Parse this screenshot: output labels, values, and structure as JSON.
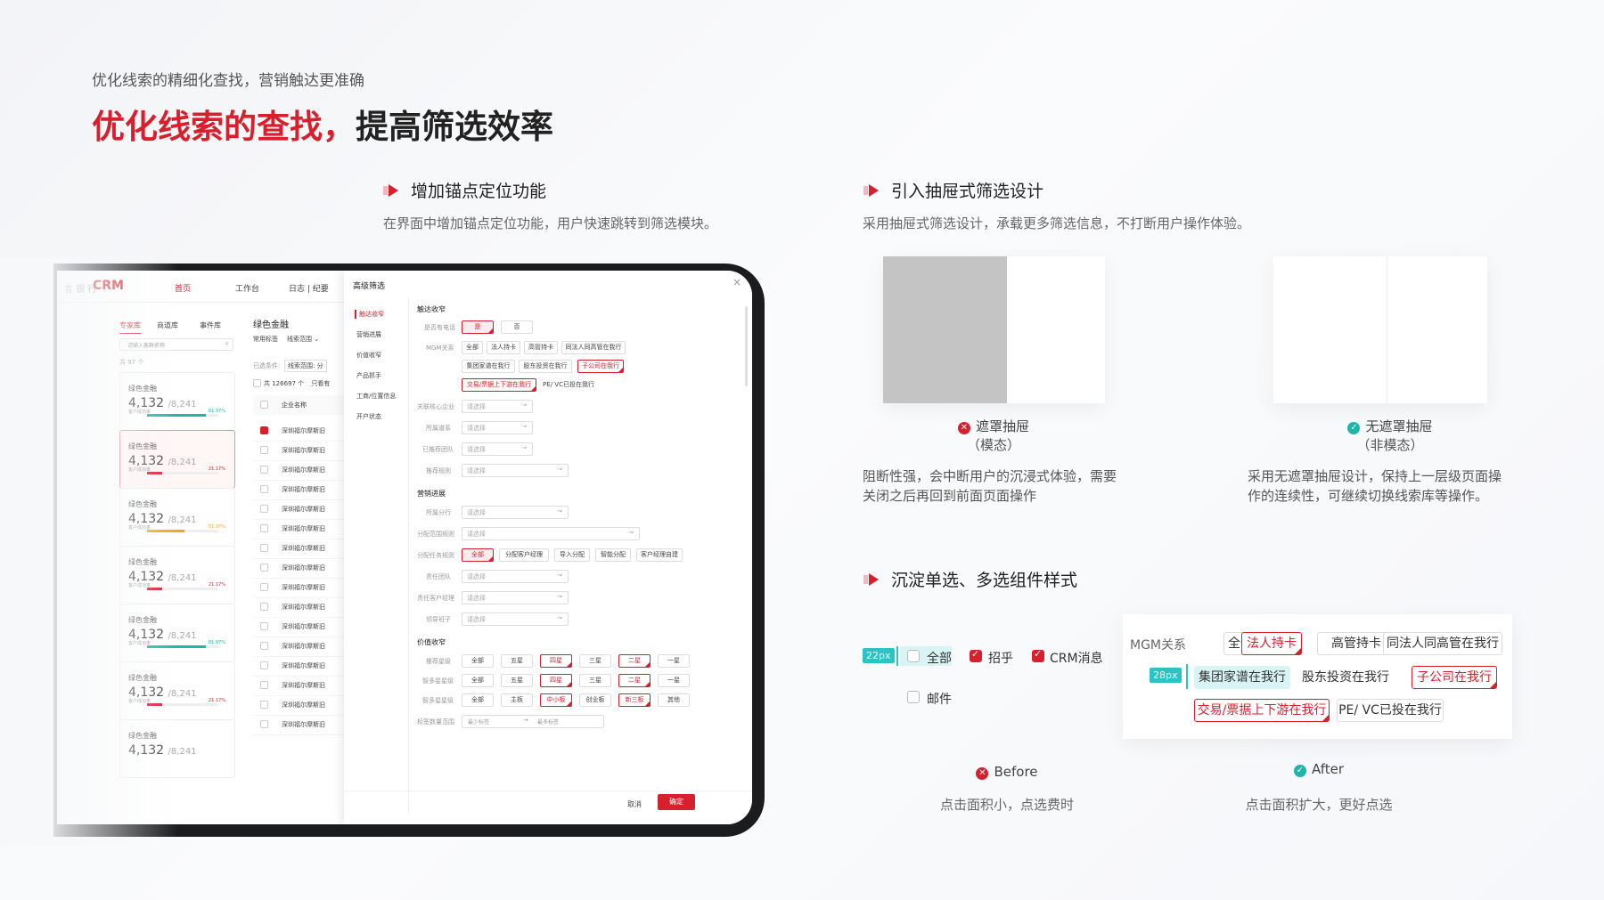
{
  "header": {
    "subtitle": "优化线索的精细化查找，营销触达更准确",
    "title_red": "优化线索的查找，",
    "title_dark": "提高筛选效率"
  },
  "sections": {
    "anchor": {
      "title": "增加锚点定位功能",
      "desc": "在界面中增加锚点定位功能，用户快速跳转到筛选模块。"
    },
    "drawer": {
      "title": "引入抽屉式筛选设计",
      "desc": "采用抽屉式筛选设计，承载更多筛选信息，不打断用户操作体验。"
    },
    "component": {
      "title": "沉淀单选、多选组件样式"
    }
  },
  "drawer_compare": {
    "modal_label": "遮罩抽屉",
    "modal_sub": "（模态）",
    "modal_desc_1": "阻断性强，会中断用户的沉浸式体验，需要",
    "modal_desc_2": "关闭之后再回到前面页面操作",
    "nonmodal_label": "无遮罩抽屉",
    "nonmodal_sub": "（非模态）",
    "nonmodal_desc_1": "采用无遮罩抽屉设计，保持上一层级页面操",
    "nonmodal_desc_2": "作的连续性，可继续切换线索库等操作。"
  },
  "component_compare": {
    "before_tag": "22px",
    "before_options": [
      "全部",
      "招乎",
      "CRM消息",
      "邮件"
    ],
    "before_label": "Before",
    "before_desc": "点击面积小，点选费时",
    "after_tag": "28px",
    "after_field": "MGM关系",
    "after_chips": [
      "全部",
      "法人持卡",
      "高管持卡",
      "同法人同高管在我行",
      "集团家谱在我行",
      "股东投资在我行",
      "子公司在我行",
      "交易/票据上下游在我行",
      "PE/ VC已投在我行"
    ],
    "after_label": "After",
    "after_desc": "点击面积扩大，更好点选"
  },
  "app": {
    "logo": "CRM",
    "logo_left": "言 银 行",
    "nav": [
      "首页",
      "工作台",
      "日志 | 纪要",
      "高级筛选"
    ],
    "left_tabs": [
      "专家库",
      "商道库",
      "事件库"
    ],
    "search_placeholder": "请输入客群名称",
    "count": "共 97 个",
    "cards": [
      {
        "label": "绿色金融",
        "num": "4,132",
        "total": "/8,241",
        "pct": "81.97%"
      },
      {
        "label": "绿色金融",
        "num": "4,132",
        "total": "/8,241",
        "pct": "21.17%"
      },
      {
        "label": "绿色金融",
        "num": "4,132",
        "total": "/8,241",
        "pct": "51.97%"
      },
      {
        "label": "绿色金融",
        "num": "4,132",
        "total": "/8,241",
        "pct": "21.17%"
      },
      {
        "label": "绿色金融",
        "num": "4,132",
        "total": "/8,241",
        "pct": "81.97%"
      },
      {
        "label": "绿色金融",
        "num": "4,132",
        "total": "/8,241",
        "pct": "21.17%"
      },
      {
        "label": "绿色金融",
        "num": "4,132",
        "total": "/8,241"
      }
    ],
    "card_sub": "客户成功率",
    "mid_title": "绿色金融",
    "mid_tabs": [
      "常用标签",
      "线索范围 ⌄"
    ],
    "mid_cond": "已选条件:",
    "mid_cond_tag": "线索范围: 分",
    "mid_total": "共 126697 个",
    "mid_total_suffix": "只看有",
    "col_header": "企业名称",
    "rows": [
      "深圳福尔摩斯旧",
      "深圳福尔摩斯旧",
      "深圳福尔摩斯旧",
      "深圳福尔摩斯旧",
      "深圳福尔摩斯旧",
      "深圳福尔摩斯旧",
      "深圳福尔摩斯旧",
      "深圳福尔摩斯旧",
      "深圳福尔摩斯旧",
      "深圳福尔摩斯旧",
      "深圳福尔摩斯旧",
      "深圳福尔摩斯旧",
      "深圳福尔摩斯旧",
      "深圳福尔摩斯旧",
      "深圳福尔摩斯旧",
      "深圳福尔摩斯旧"
    ],
    "anchors": [
      "触达收窄",
      "营销进展",
      "价值收窄",
      "产品抓手",
      "工商/位置信息",
      "开户状态"
    ],
    "panel": {
      "sec1": "触达收窄",
      "phone_label": "是否有电话",
      "yes": "是",
      "no": "否",
      "mgm_label": "MGM关系",
      "mgm_chips": [
        "全部",
        "法人持卡",
        "高管持卡",
        "同法人同高管在我行",
        "集团家谱在我行",
        "股东投资在我行",
        "子公司在我行",
        "交易/票据上下游在我行",
        "PE/ VC已投在我行"
      ],
      "f1": "关联核心企业",
      "f2": "所属谱系",
      "f3": "已推荐团队",
      "f4": "推荐规则",
      "placeholder": "请选择",
      "sec2": "营销进展",
      "g1": "所属分行",
      "g2": "分配范围规则",
      "g3": "分配任务规则",
      "g3_chips": [
        "全部",
        "分配客户经理",
        "导入分配",
        "智能分配",
        "客户经理自建"
      ],
      "g4": "责任团队",
      "g5": "责任客户经理",
      "g6": "领导班子",
      "sec3": "价值收窄",
      "r1": "推荐星级",
      "r2": "智多星星级",
      "r3": "智多星星级",
      "star_chips": [
        "全部",
        "五星",
        "四星",
        "三星",
        "二星",
        "一星"
      ],
      "board_chips": [
        "全部",
        "主板",
        "中小板",
        "创业板",
        "新三板",
        "其他"
      ],
      "r4": "标签数量范围",
      "min_ph": "最少标签",
      "max_ph": "最多标签",
      "cancel": "取消",
      "ok": "确定"
    }
  }
}
